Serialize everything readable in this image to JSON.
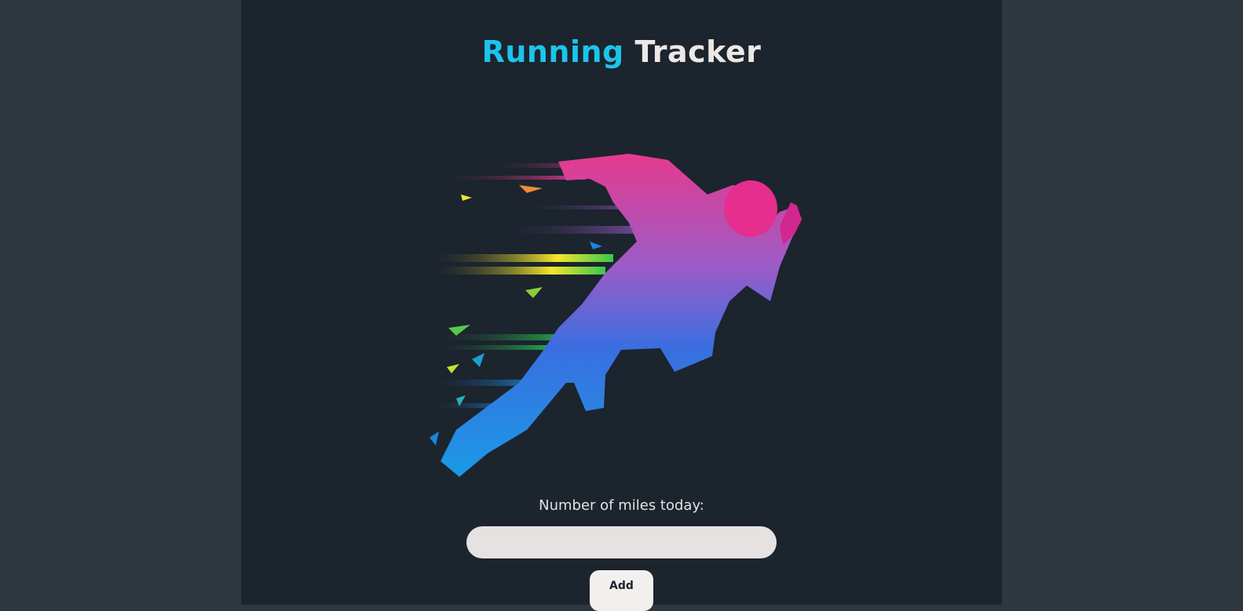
{
  "header": {
    "title_part1": "Running",
    "title_part2": "Tracker"
  },
  "hero": {
    "image": "running-figure-illustration"
  },
  "form": {
    "miles_label": "Number of miles today:",
    "miles_value": "",
    "miles_placeholder": "",
    "add_label": "Add"
  },
  "colors": {
    "accent": "#1cc4ec",
    "background": "#1c242e",
    "outer_background": "#2e3640"
  }
}
